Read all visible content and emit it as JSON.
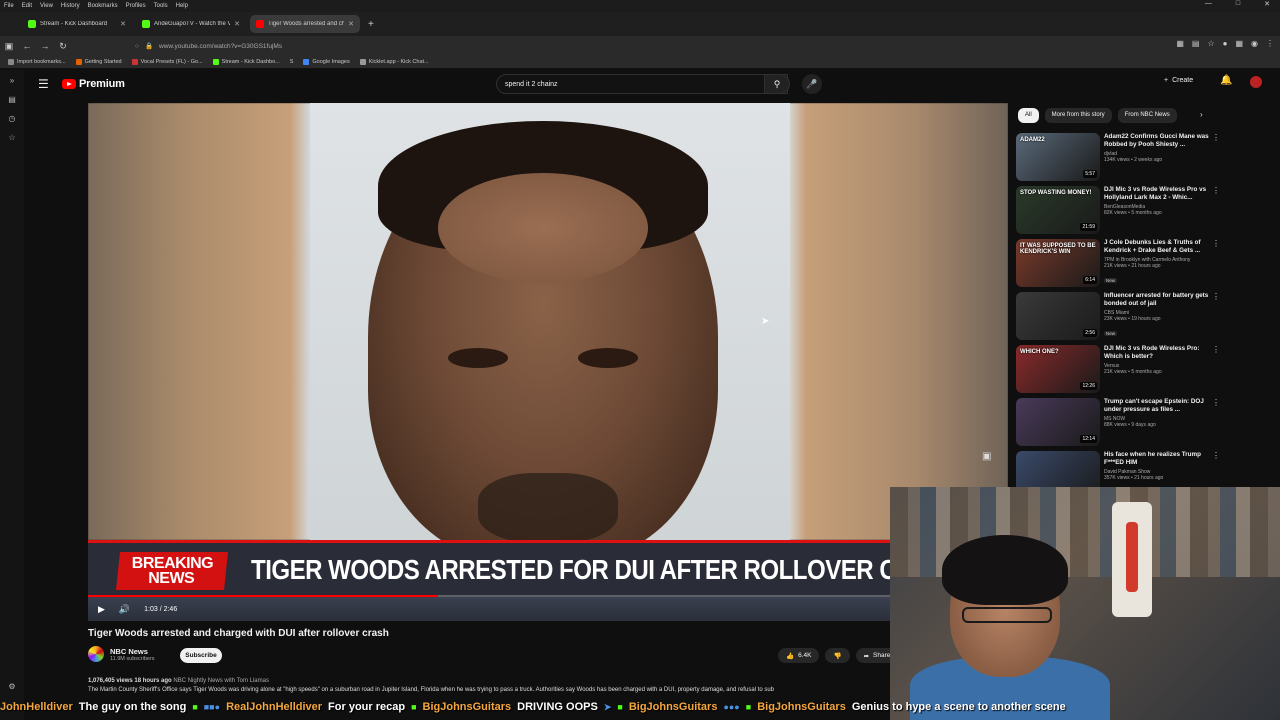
{
  "os_menu": [
    "File",
    "Edit",
    "View",
    "History",
    "Bookmarks",
    "Profiles",
    "Tools",
    "Help"
  ],
  "tabs": [
    {
      "title": "Stream - Kick Dashboard",
      "color": "#53fc18",
      "active": false
    },
    {
      "title": "AndeGuapoTV - Watch the VOD",
      "color": "#53fc18",
      "active": false
    },
    {
      "title": "Tiger Woods arrested and charged",
      "color": "#ff0000",
      "active": true
    }
  ],
  "url": "www.youtube.com/watch?v=G30GS1fujMs",
  "bookmarks": [
    {
      "label": "Import bookmarks...",
      "color": "#888888"
    },
    {
      "label": "Getting Started",
      "color": "#e66000"
    },
    {
      "label": "Vocal Presets (FL) - Go...",
      "color": "#cc3333"
    },
    {
      "label": "Stream - Kick Dashbo...",
      "color": "#53fc18"
    },
    {
      "label": "S",
      "color": "#444444"
    },
    {
      "label": "Google Images",
      "color": "#4285f4"
    },
    {
      "label": "Kicklet.app - Kick Chat...",
      "color": "#999999"
    }
  ],
  "masthead": {
    "logo_text": "Premium",
    "search_value": "spend it 2 chainz",
    "create_label": "Create"
  },
  "video": {
    "breaking_line1": "BREAKING",
    "breaking_line2": "NEWS",
    "headline": "TIGER WOODS ARRESTED FOR DUI AFTER ROLLOVER CRASH",
    "time": "1:03 / 2:46",
    "progress_fraction": 0.38
  },
  "details": {
    "title": "Tiger Woods arrested and charged with DUI after rollover crash",
    "channel": "NBC News",
    "subscribers": "11.9M subscribers",
    "subscribe_label": "Subscribe",
    "likes": "6.4K",
    "share_label": "Share",
    "stats": "1,076,405 views  18 hours ago",
    "tags": "NBC Nightly News with Tom Llamas",
    "description": "The Martin County Sheriff's Office says Tiger Woods was driving alone at \"high speeds\" on a suburban road in Jupiter Island, Florida when he was trying to pass a truck. Authorities say Woods has been charged with a DUI, property damage, and refusal to sub"
  },
  "chips": [
    "All",
    "More from this story",
    "From NBC News"
  ],
  "recommendations": [
    {
      "title": "Adam22 Confirms Gucci Mane was Robbed by Pooh Shiesty ...",
      "channel": "djvlad",
      "meta": "134K views • 2 weeks ago",
      "duration": "5:57",
      "thumb_text": "ADAM22",
      "thumb_color": "#5a6a7a",
      "new": ""
    },
    {
      "title": "DJI Mic 3 vs Rode Wireless Pro vs Hollyland Lark Max 2 - Whic...",
      "channel": "BenGleasonMedia",
      "meta": "82K views • 5 months ago",
      "duration": "21:59",
      "thumb_text": "STOP WASTING MONEY!",
      "thumb_color": "#2a3a2a",
      "new": ""
    },
    {
      "title": "J Cole Debunks Lies & Truths of Kendrick + Drake Beef & Gets ...",
      "channel": "7PM in Brooklyn with Carmelo Anthony",
      "meta": "21K views • 21 hours ago",
      "duration": "6:14",
      "thumb_text": "IT WAS SUPPOSED TO BE KENDRICK'S WIN",
      "thumb_color": "#7a3a2a",
      "new": "New"
    },
    {
      "title": "Influencer arrested for battery gets bonded out of jail",
      "channel": "CBS Miami",
      "meta": "23K views • 19 hours ago",
      "duration": "2:56",
      "thumb_text": "",
      "thumb_color": "#3a3a3a",
      "new": "New"
    },
    {
      "title": "DJI Mic 3 vs Rode Wireless Pro: Which is better?",
      "channel": "Versus",
      "meta": "21K views • 5 months ago",
      "duration": "12:26",
      "thumb_text": "WHICH ONE?",
      "thumb_color": "#8a2a2a",
      "new": ""
    },
    {
      "title": "Trump can't escape Epstein: DOJ under pressure as files ...",
      "channel": "MS NOW",
      "meta": "88K views • 9 days ago",
      "duration": "12:14",
      "thumb_text": "",
      "thumb_color": "#4a3a5a",
      "new": ""
    },
    {
      "title": "His face when he realizes Trump F***ED HIM",
      "channel": "David Pakman Show",
      "meta": "357K views • 21 hours ago",
      "duration": "",
      "thumb_text": "",
      "thumb_color": "#3a4a6a",
      "new": ""
    }
  ],
  "ticker": {
    "user1": "JohnHelldiver",
    "msg1": "The guy on the song",
    "user2": "RealJohnHelldiver",
    "msg2": "For your recap",
    "user3": "BigJohnsGuitars",
    "msg3": "DRIVING OOPS",
    "user4": "BigJohnsGuitars",
    "user5": "BigJohnsGuitars",
    "msg5": "Genius to hype a scene to another scene"
  }
}
